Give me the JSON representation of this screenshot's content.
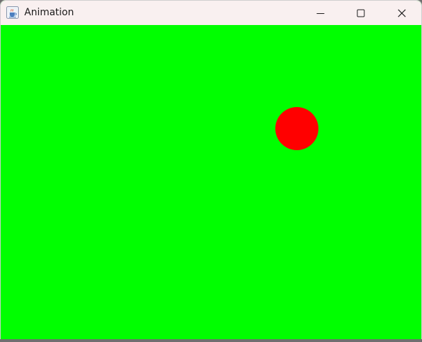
{
  "window": {
    "title": "Animation",
    "app_icon": "java-cup-icon",
    "controls": {
      "minimize_icon": "minimize-icon",
      "maximize_icon": "maximize-icon",
      "close_icon": "close-icon"
    }
  },
  "canvas": {
    "background_color": "#00ff00",
    "ball_color": "#ff0000"
  }
}
